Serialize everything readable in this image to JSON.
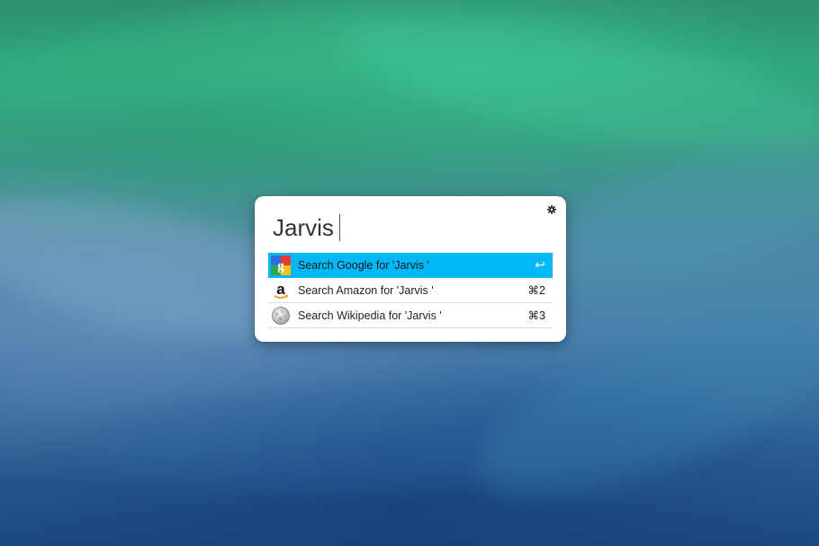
{
  "launcher": {
    "query": "Jarvis",
    "settings_icon": "gear-icon",
    "results": [
      {
        "label": "Search Google for 'Jarvis '",
        "shortcut": "↩",
        "icon": "google-icon",
        "selected": true
      },
      {
        "label": "Search Amazon for 'Jarvis '",
        "shortcut": "⌘2",
        "icon": "amazon-icon",
        "selected": false
      },
      {
        "label": "Search Wikipedia for 'Jarvis '",
        "shortcut": "⌘3",
        "icon": "wikipedia-icon",
        "selected": false
      }
    ]
  },
  "colors": {
    "selection": "#00b8f5",
    "panel": "#ffffff"
  }
}
